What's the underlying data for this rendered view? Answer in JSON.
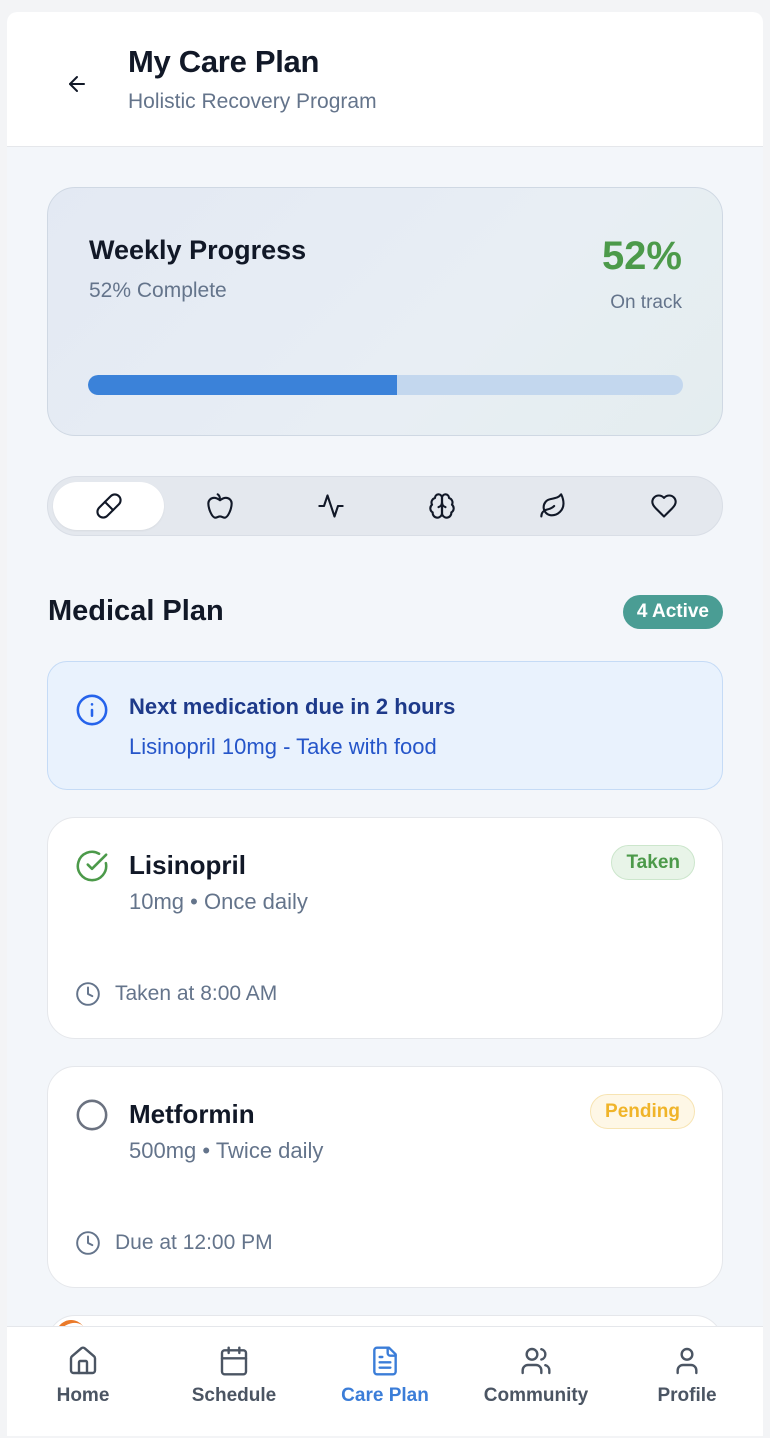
{
  "header": {
    "title": "My Care Plan",
    "subtitle": "Holistic Recovery Program",
    "back_icon": "arrow-left-icon"
  },
  "progress": {
    "title": "Weekly Progress",
    "subtitle": "52% Complete",
    "percent_label": "52%",
    "status": "On track",
    "value": 0.52,
    "colors": {
      "fill": "#3b82d9",
      "track": "#c3d7ee",
      "percent": "#4c9a4a"
    }
  },
  "category_tabs": [
    {
      "icon": "pill-icon",
      "active": true
    },
    {
      "icon": "apple-icon",
      "active": false
    },
    {
      "icon": "activity-icon",
      "active": false
    },
    {
      "icon": "brain-icon",
      "active": false
    },
    {
      "icon": "leaf-icon",
      "active": false
    },
    {
      "icon": "heart-icon",
      "active": false
    }
  ],
  "section": {
    "title": "Medical Plan",
    "badge": "4 Active"
  },
  "alert": {
    "icon": "info-icon",
    "title": "Next medication due in 2 hours",
    "detail": "Lisinopril 10mg - Take with food"
  },
  "medications": [
    {
      "name": "Lisinopril",
      "dose": "10mg",
      "frequency": "Once daily",
      "status": "Taken",
      "time_text": "Taken at 8:00 AM",
      "icon": "check-circle-icon"
    },
    {
      "name": "Metformin",
      "dose": "500mg",
      "frequency": "Twice daily",
      "status": "Pending",
      "time_text": "Due at 12:00 PM",
      "icon": "empty-circle-icon"
    }
  ],
  "bottom_nav": [
    {
      "label": "Home",
      "icon": "home-icon",
      "active": false
    },
    {
      "label": "Schedule",
      "icon": "calendar-icon",
      "active": false
    },
    {
      "label": "Care Plan",
      "icon": "document-icon",
      "active": true
    },
    {
      "label": "Community",
      "icon": "users-icon",
      "active": false
    },
    {
      "label": "Profile",
      "icon": "user-icon",
      "active": false
    }
  ]
}
